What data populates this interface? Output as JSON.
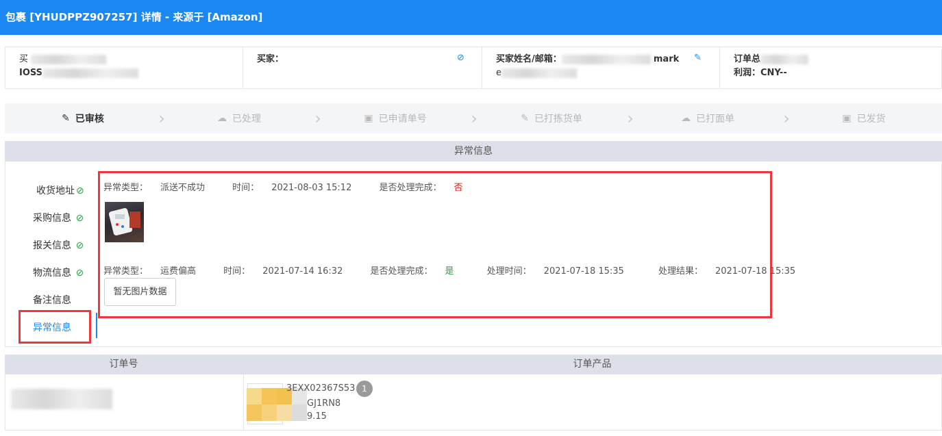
{
  "header": {
    "title": "包裹 [YHUDPPZ907257] 详情 - 来源于 [Amazon]"
  },
  "info": {
    "cell1_line1": "买",
    "cell1_line2": "IOSS",
    "buyer_label": "买家：",
    "buyer_name_email_label": "买家姓名/邮箱：",
    "remark_text": "mark",
    "cell3_line2": "e",
    "order_total_label": "订单总",
    "profit": "利润：CNY--"
  },
  "steps": [
    {
      "label": "已审核",
      "icon": "edit-icon",
      "active": true
    },
    {
      "label": "已处理",
      "icon": "cloud-upload-icon",
      "active": false
    },
    {
      "label": "已申请单号",
      "icon": "image-icon",
      "active": false
    },
    {
      "label": "已打拣货单",
      "icon": "edit-icon",
      "active": false
    },
    {
      "label": "已打面单",
      "icon": "cloud-upload-icon",
      "active": false
    },
    {
      "label": "已发货",
      "icon": "image-icon",
      "active": false
    }
  ],
  "section_title": "异常信息",
  "sidebar": [
    {
      "label": "收货地址",
      "ok": true
    },
    {
      "label": "采购信息",
      "ok": true
    },
    {
      "label": "报关信息",
      "ok": true
    },
    {
      "label": "物流信息",
      "ok": true
    },
    {
      "label": "备注信息",
      "ok": false
    },
    {
      "label": "异常信息",
      "ok": false,
      "active": true
    }
  ],
  "exceptions": [
    {
      "type_label": "异常类型：",
      "type": "派送不成功",
      "time_label": "时间：",
      "time": "2021-08-03 15:12",
      "done_label": "是否处理完成：",
      "done": "否"
    },
    {
      "type_label": "异常类型：",
      "type": "运费偏高",
      "time_label": "时间：",
      "time": "2021-07-14 16:32",
      "done_label": "是否处理完成：",
      "done": "是",
      "handle_time_label": "处理时间：",
      "handle_time": "2021-07-18 15:35",
      "result_label": "处理结果：",
      "result": "2021-07-18 15:35",
      "no_image": "暂无图片数据"
    }
  ],
  "orders_table": {
    "col_order_no": "订单号",
    "col_products": "订单产品",
    "product": {
      "sku": "3EXX02367S53",
      "code": "GJ1RN8",
      "price": "9.15",
      "qty": "1"
    }
  },
  "colors": {
    "accent": "#1b87f0",
    "highlight_box": "#f2353b",
    "ok": "#2e9e4a",
    "no": "#d81e06"
  }
}
